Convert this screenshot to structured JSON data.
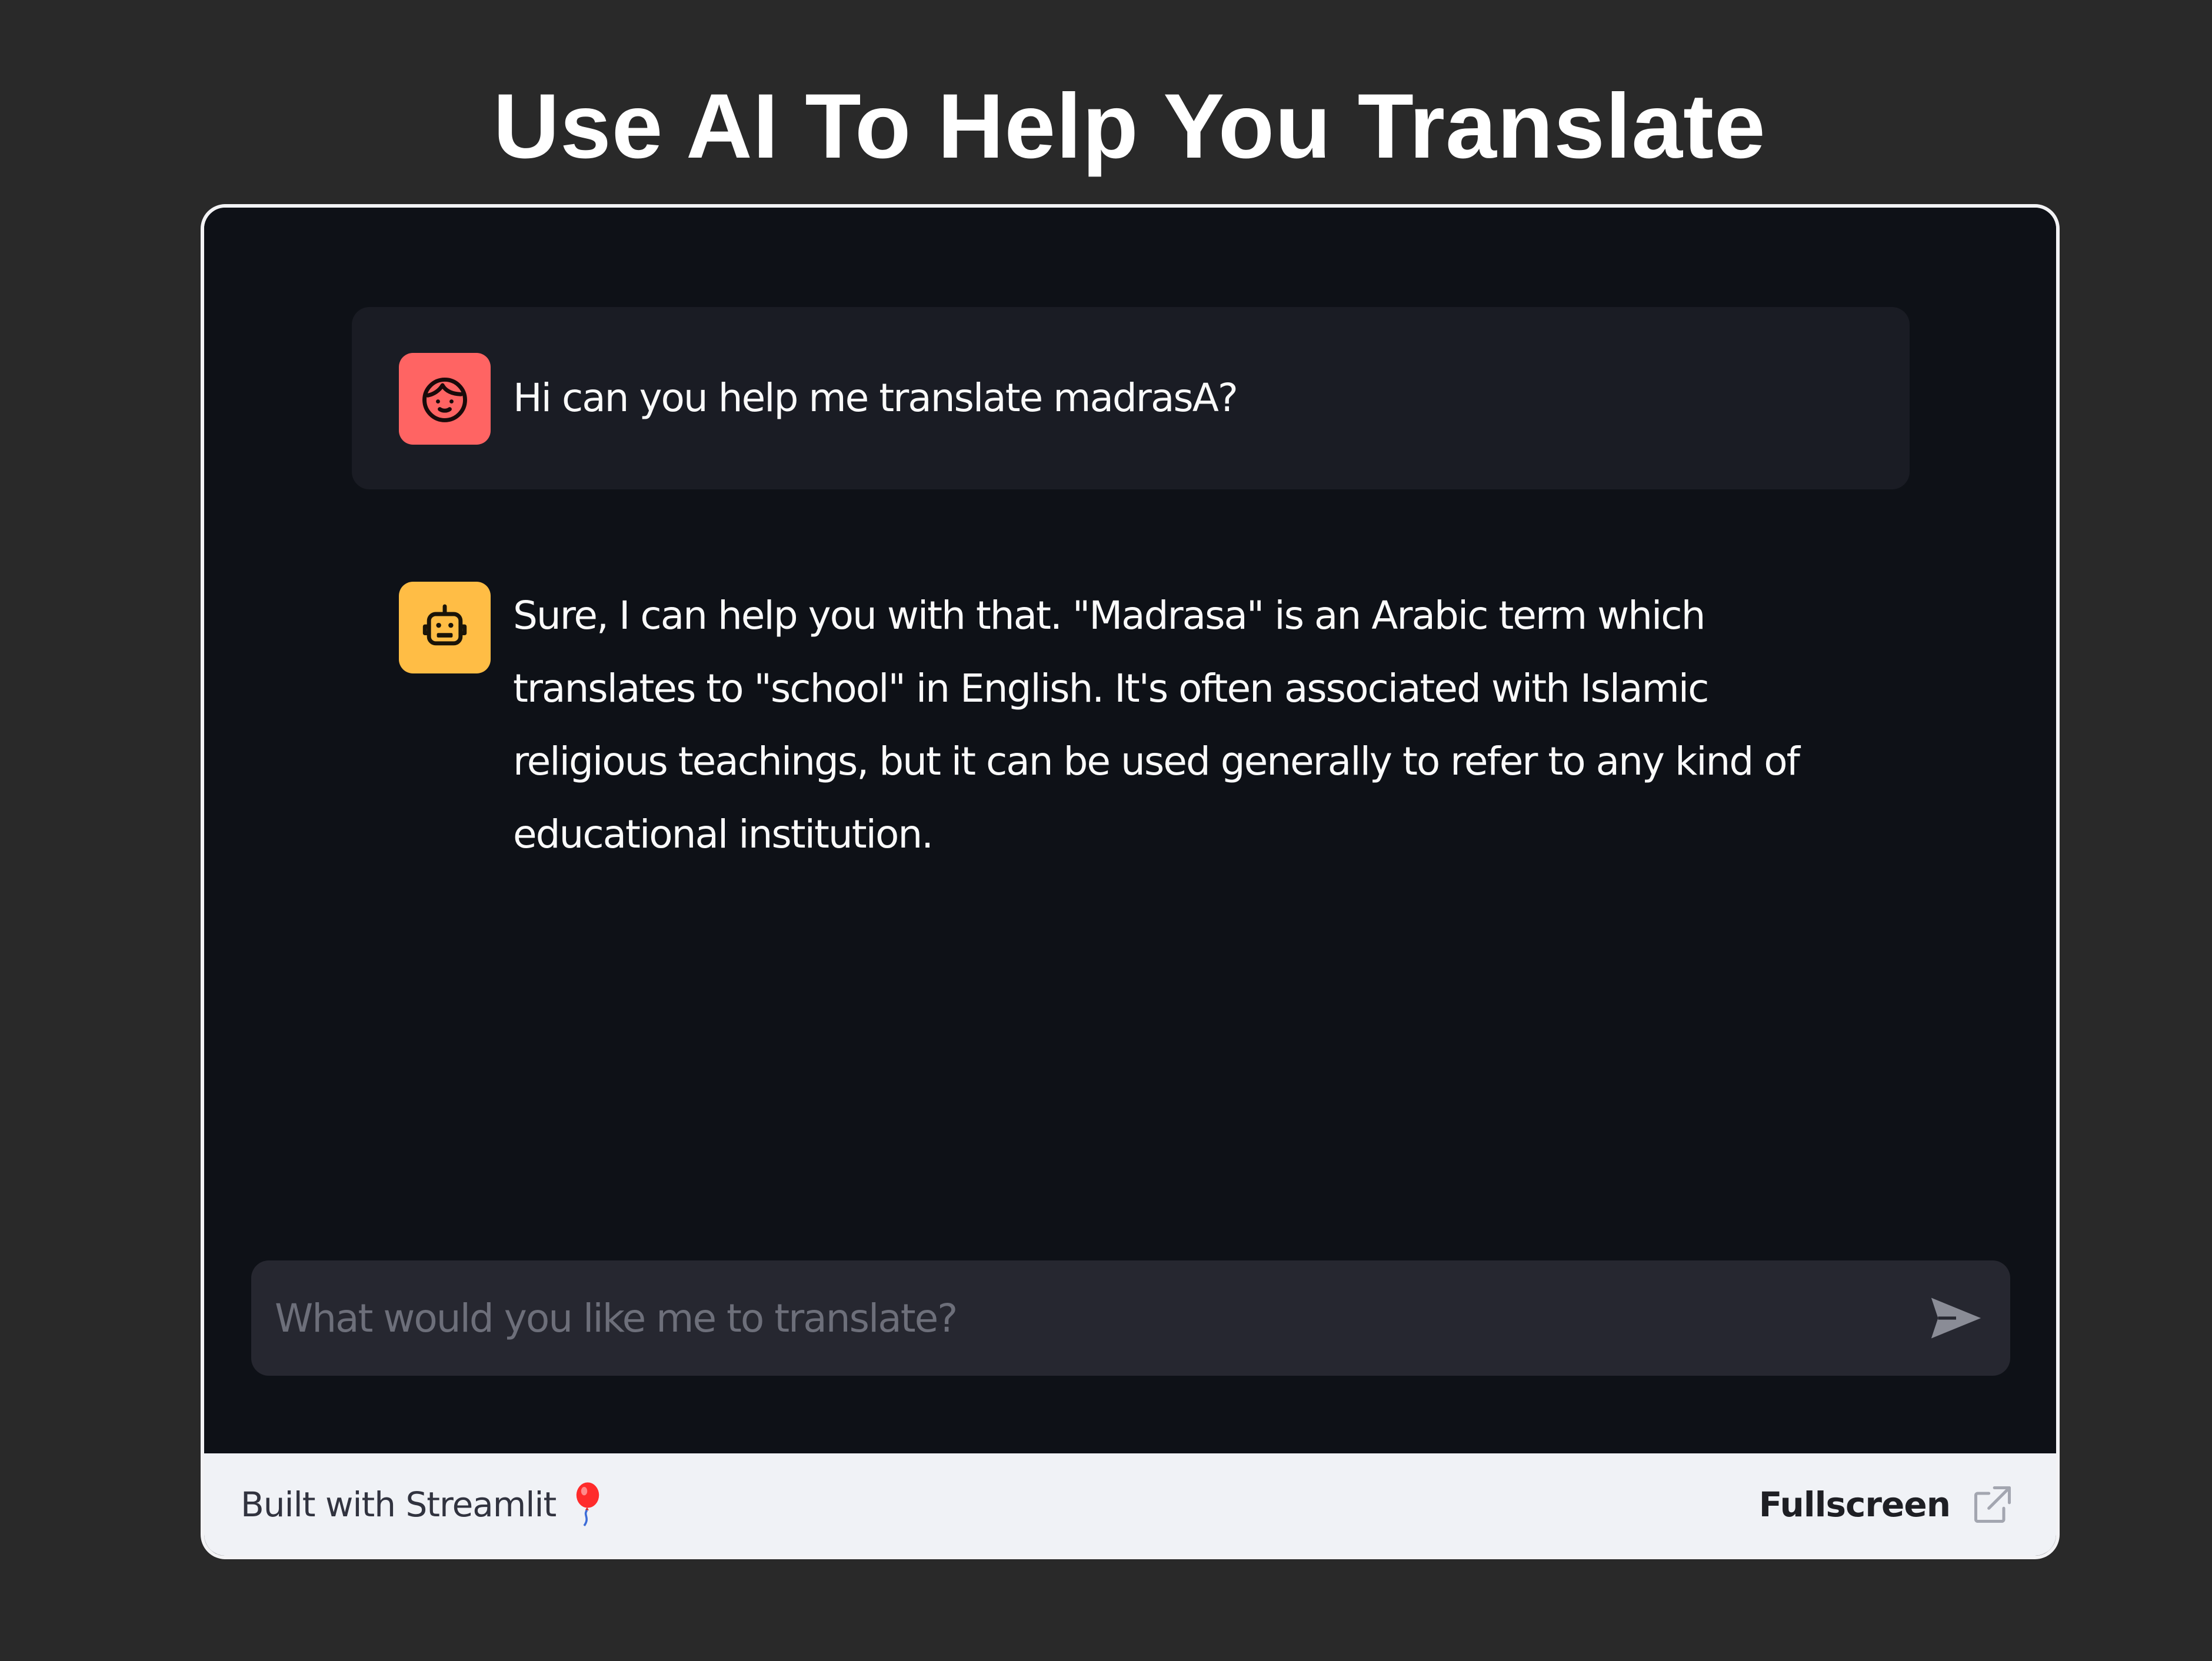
{
  "page": {
    "title": "Use AI To Help You Translate"
  },
  "chat": {
    "messages": [
      {
        "role": "user",
        "avatar_icon": "user-face-icon",
        "avatar_color": "#ff6463",
        "text": "Hi can you help me translate madrasA?"
      },
      {
        "role": "assistant",
        "avatar_icon": "robot-icon",
        "avatar_color": "#ffbd45",
        "text": "Sure, I can help you with that. \"Madrasa\" is an Arabic term which translates to \"school\" in English. It's often associated with Islamic religious teachings, but it can be used generally to refer to any kind of educational institution."
      }
    ],
    "input": {
      "placeholder": "What would you like me to translate?",
      "value": "",
      "send_icon": "send-icon"
    }
  },
  "footer": {
    "built_with": "Built with Streamlit",
    "balloon_icon": "balloon-icon",
    "fullscreen_label": "Fullscreen",
    "fullscreen_icon": "external-link-icon"
  },
  "colors": {
    "page_background": "#292929",
    "app_background": "#0e1117",
    "user_message_background": "#1a1c24",
    "input_background": "#262730",
    "footer_background": "#f0f2f6",
    "user_avatar": "#ff6463",
    "assistant_avatar": "#ffbd45"
  }
}
